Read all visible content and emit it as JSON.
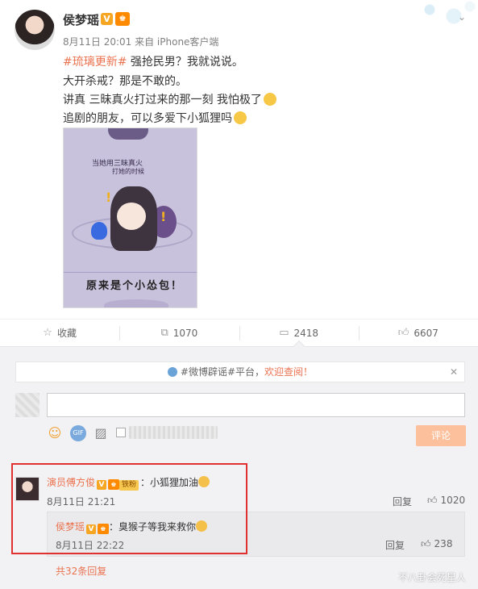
{
  "post": {
    "username": "侯梦瑶",
    "verified_badge": "V",
    "meta": "8月11日 20:01 来自 iPhone客户端",
    "lines": [
      {
        "tag": "#琉璃更新#",
        "text": " 强抢民男？我就说说。"
      },
      {
        "text": "大开杀戒？那是不敢的。"
      },
      {
        "text": "讲真 三昧真火打过来的那一刻 我怕极了"
      },
      {
        "text": "追剧的朋友，可以多爱下小狐狸吗"
      }
    ],
    "image": {
      "caption_top": "当她用三昧真火",
      "caption_sub": "打她的时候",
      "caption_bottom": "原来是个小怂包！"
    }
  },
  "actions": {
    "favorite": {
      "icon": "star-icon",
      "label": "收藏"
    },
    "repost": {
      "icon": "repost-icon",
      "label": "1070"
    },
    "comment": {
      "icon": "comment-icon",
      "label": "2418"
    },
    "like": {
      "icon": "thumbs-up-icon",
      "label": "6607"
    }
  },
  "comments_section": {
    "notice": {
      "text": "#微博辟谣#平台，",
      "link": "欢迎查阅！"
    },
    "submit_label": "评论",
    "comments": [
      {
        "user": "演员傅方俊",
        "verified": "V",
        "fan_badge": "铁粉",
        "text": "：小狐狸加油",
        "time": "8月11日 21:21",
        "reply_label": "回复",
        "likes": "1020",
        "replies": [
          {
            "user": "侯梦瑶",
            "verified": "V",
            "text": "：臭猴子等我来救你",
            "time": "8月11日 22:22",
            "reply_label": "回复",
            "likes": "238"
          }
        ],
        "more_replies": "共32条回复"
      }
    ]
  },
  "watermark": "不八卦会死星人",
  "colors": {
    "accent": "#eb7350",
    "highlight": "#e03030",
    "submit": "#fdc09c"
  }
}
